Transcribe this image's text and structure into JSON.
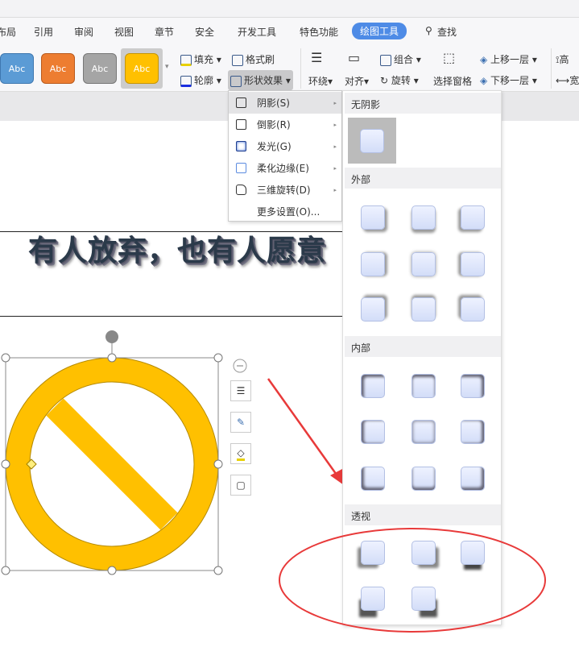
{
  "tabs": [
    "布局",
    "引用",
    "审阅",
    "视图",
    "章节",
    "安全",
    "开发工具",
    "特色功能",
    "绘图工具",
    "查找"
  ],
  "ribbon": {
    "swatches": [
      {
        "label": "Abc",
        "color": "#5b9bd5"
      },
      {
        "label": "Abc",
        "color": "#ed7d31"
      },
      {
        "label": "Abc",
        "color": "#a5a5a5"
      },
      {
        "label": "Abc",
        "color": "#ffc000"
      }
    ],
    "fill": "填充",
    "outline": "轮廓",
    "format_painter": "格式刷",
    "shape_effects": "形状效果",
    "wrap": "环绕",
    "align": "对齐",
    "group": "组合",
    "rotate": "旋转",
    "selection_pane": "选择窗格",
    "bring_forward": "上移一层",
    "send_backward": "下移一层",
    "height": "高",
    "width": "宽"
  },
  "document": {
    "heading": "有人放弃，也有人愿意"
  },
  "menu": {
    "items": [
      "阴影(S)",
      "倒影(R)",
      "发光(G)",
      "柔化边缘(E)",
      "三维旋转(D)",
      "更多设置(O)..."
    ]
  },
  "submenu": {
    "no_shadow": "无阴影",
    "outer": "外部",
    "inner": "内部",
    "perspective": "透视"
  },
  "colors": {
    "accent": "#4e8be6",
    "shape": "#ffc000",
    "annotation": "#e83a3a"
  }
}
